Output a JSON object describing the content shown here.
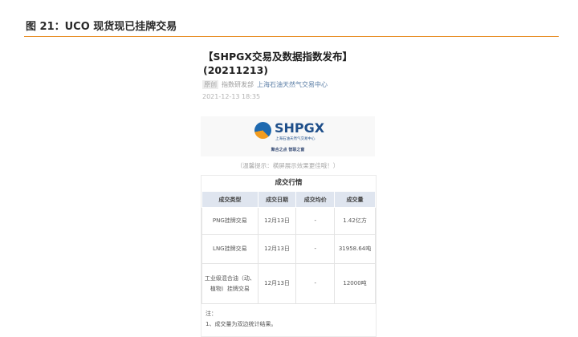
{
  "figure": {
    "title": "图 21：UCO 现货现已挂牌交易"
  },
  "article": {
    "title": "【SHPGX交易及数据指数发布】(20211213)",
    "tag": "原创",
    "department": "指数研发部",
    "source": "上海石油天然气交易中心",
    "date": "2021-12-13 18:35"
  },
  "banner": {
    "logo_text": "SHPGX",
    "logo_subtitle": "上海石油天然气交易中心",
    "slogan": "聚合之点 智联之窗",
    "hint": "（温馨提示：横屏展示效果更佳哦！）"
  },
  "trade_table": {
    "title": "成交行情",
    "headers": [
      "成交类型",
      "成交日期",
      "成交均价",
      "成交量"
    ],
    "rows": [
      [
        "PNG挂牌交易",
        "12月13日",
        "-",
        "1.42亿方"
      ],
      [
        "LNG挂牌交易",
        "12月13日",
        "-",
        "31958.64吨"
      ],
      [
        "工业级混合油（动、植物）挂牌交易",
        "12月13日",
        "-",
        "12000吨"
      ]
    ],
    "notes": [
      "注：",
      "1、成交量为双边统计结果。"
    ]
  },
  "colors": {
    "accent_rule": "#e8902a",
    "table_header_bg": "#dfe5ef",
    "logo_blue": "#1f4f8a",
    "logo_orange": "#f29c1f"
  }
}
